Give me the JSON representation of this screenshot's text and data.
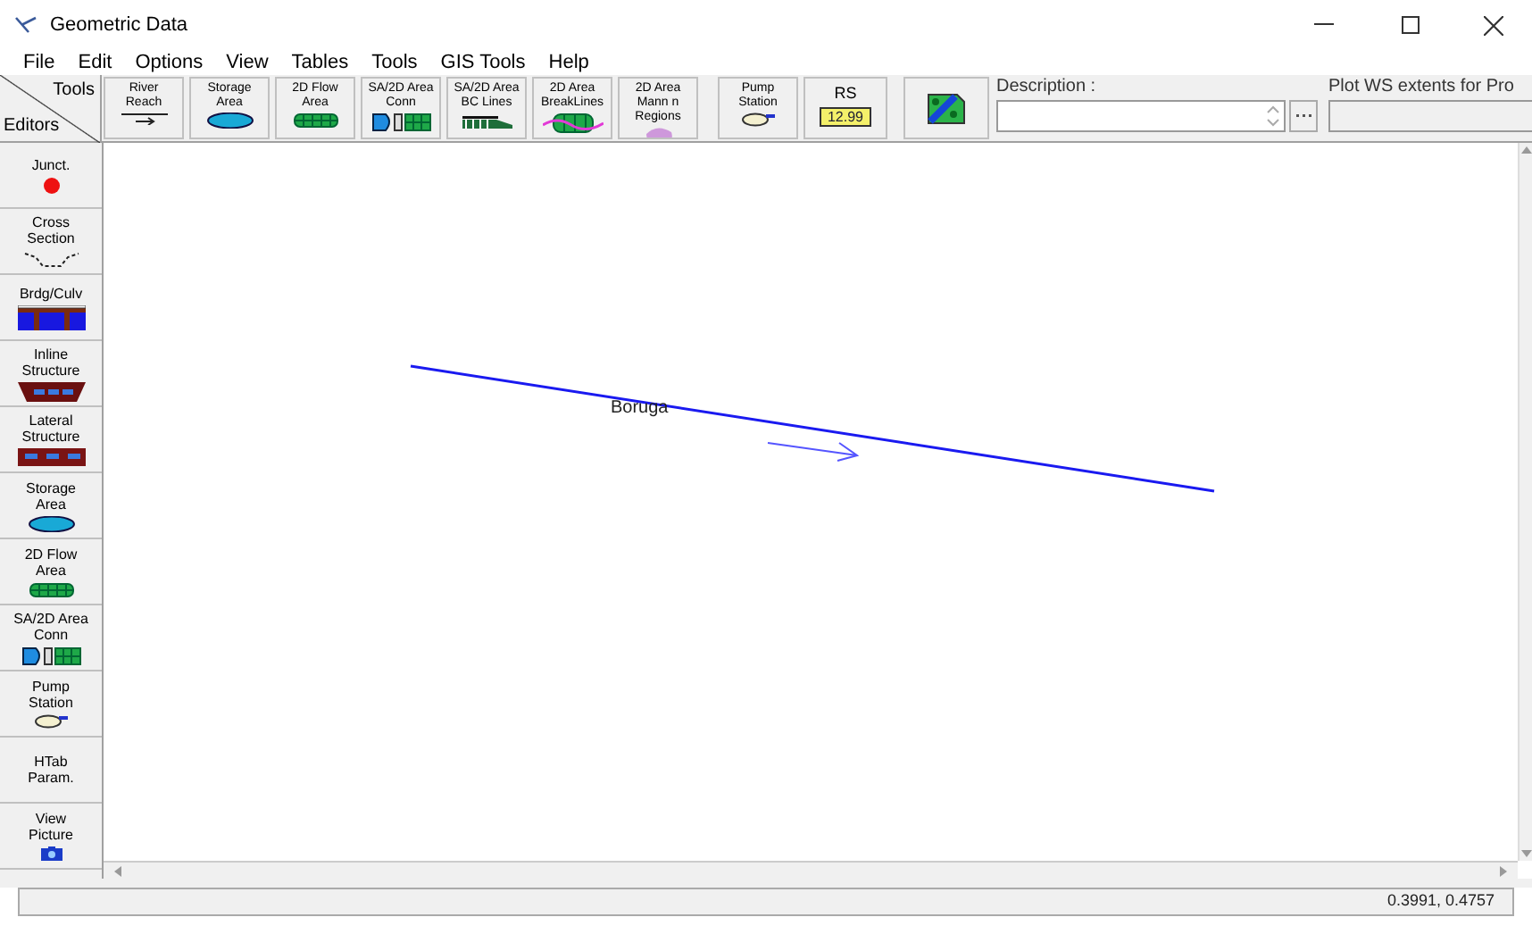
{
  "window": {
    "title": "Geometric Data"
  },
  "menu": [
    "File",
    "Edit",
    "Options",
    "View",
    "Tables",
    "Tools",
    "GIS Tools",
    "Help"
  ],
  "corner": {
    "top": "Tools",
    "bottom": "Editors"
  },
  "tools": [
    {
      "lines": [
        "River",
        "Reach"
      ],
      "kind": "reach"
    },
    {
      "lines": [
        "Storage",
        "Area"
      ],
      "kind": "storage"
    },
    {
      "lines": [
        "2D Flow",
        "Area"
      ],
      "kind": "flow"
    },
    {
      "lines": [
        "SA/2D Area",
        "Conn"
      ],
      "kind": "conn"
    },
    {
      "lines": [
        "SA/2D Area",
        "BC Lines"
      ],
      "kind": "bc"
    },
    {
      "lines": [
        "2D Area",
        "BreakLines"
      ],
      "kind": "breaklines"
    },
    {
      "lines": [
        "2D Area",
        "Mann n",
        "Regions"
      ],
      "kind": "mann"
    },
    {
      "lines": [
        "Pump",
        "Station"
      ],
      "kind": "pump"
    },
    {
      "lines": [
        "RS"
      ],
      "kind": "rs",
      "tag": "12.99"
    },
    {
      "kind": "map"
    }
  ],
  "description": {
    "label": "Description :"
  },
  "plot_ws": {
    "label": "Plot WS extents for Pro"
  },
  "editors": [
    {
      "lines": [
        "Junct."
      ],
      "kind": "junction"
    },
    {
      "lines": [
        "Cross",
        "Section"
      ],
      "kind": "xs"
    },
    {
      "lines": [
        "Brdg/Culv"
      ],
      "kind": "bridge"
    },
    {
      "lines": [
        "Inline",
        "Structure"
      ],
      "kind": "inline"
    },
    {
      "lines": [
        "Lateral",
        "Structure"
      ],
      "kind": "lateral"
    },
    {
      "lines": [
        "Storage",
        "Area"
      ],
      "kind": "storage"
    },
    {
      "lines": [
        "2D Flow",
        "Area"
      ],
      "kind": "flow"
    },
    {
      "lines": [
        "SA/2D Area",
        "Conn"
      ],
      "kind": "conn"
    },
    {
      "lines": [
        "Pump",
        "Station"
      ],
      "kind": "pump"
    },
    {
      "lines": [
        "HTab",
        "Param."
      ],
      "kind": "text"
    },
    {
      "lines": [
        "View",
        "Picture"
      ],
      "kind": "camera"
    }
  ],
  "canvas": {
    "reaches": [
      {
        "label": "Boruga"
      }
    ]
  },
  "status_bar": {
    "coordinates": "0.3991, 0.4757"
  }
}
